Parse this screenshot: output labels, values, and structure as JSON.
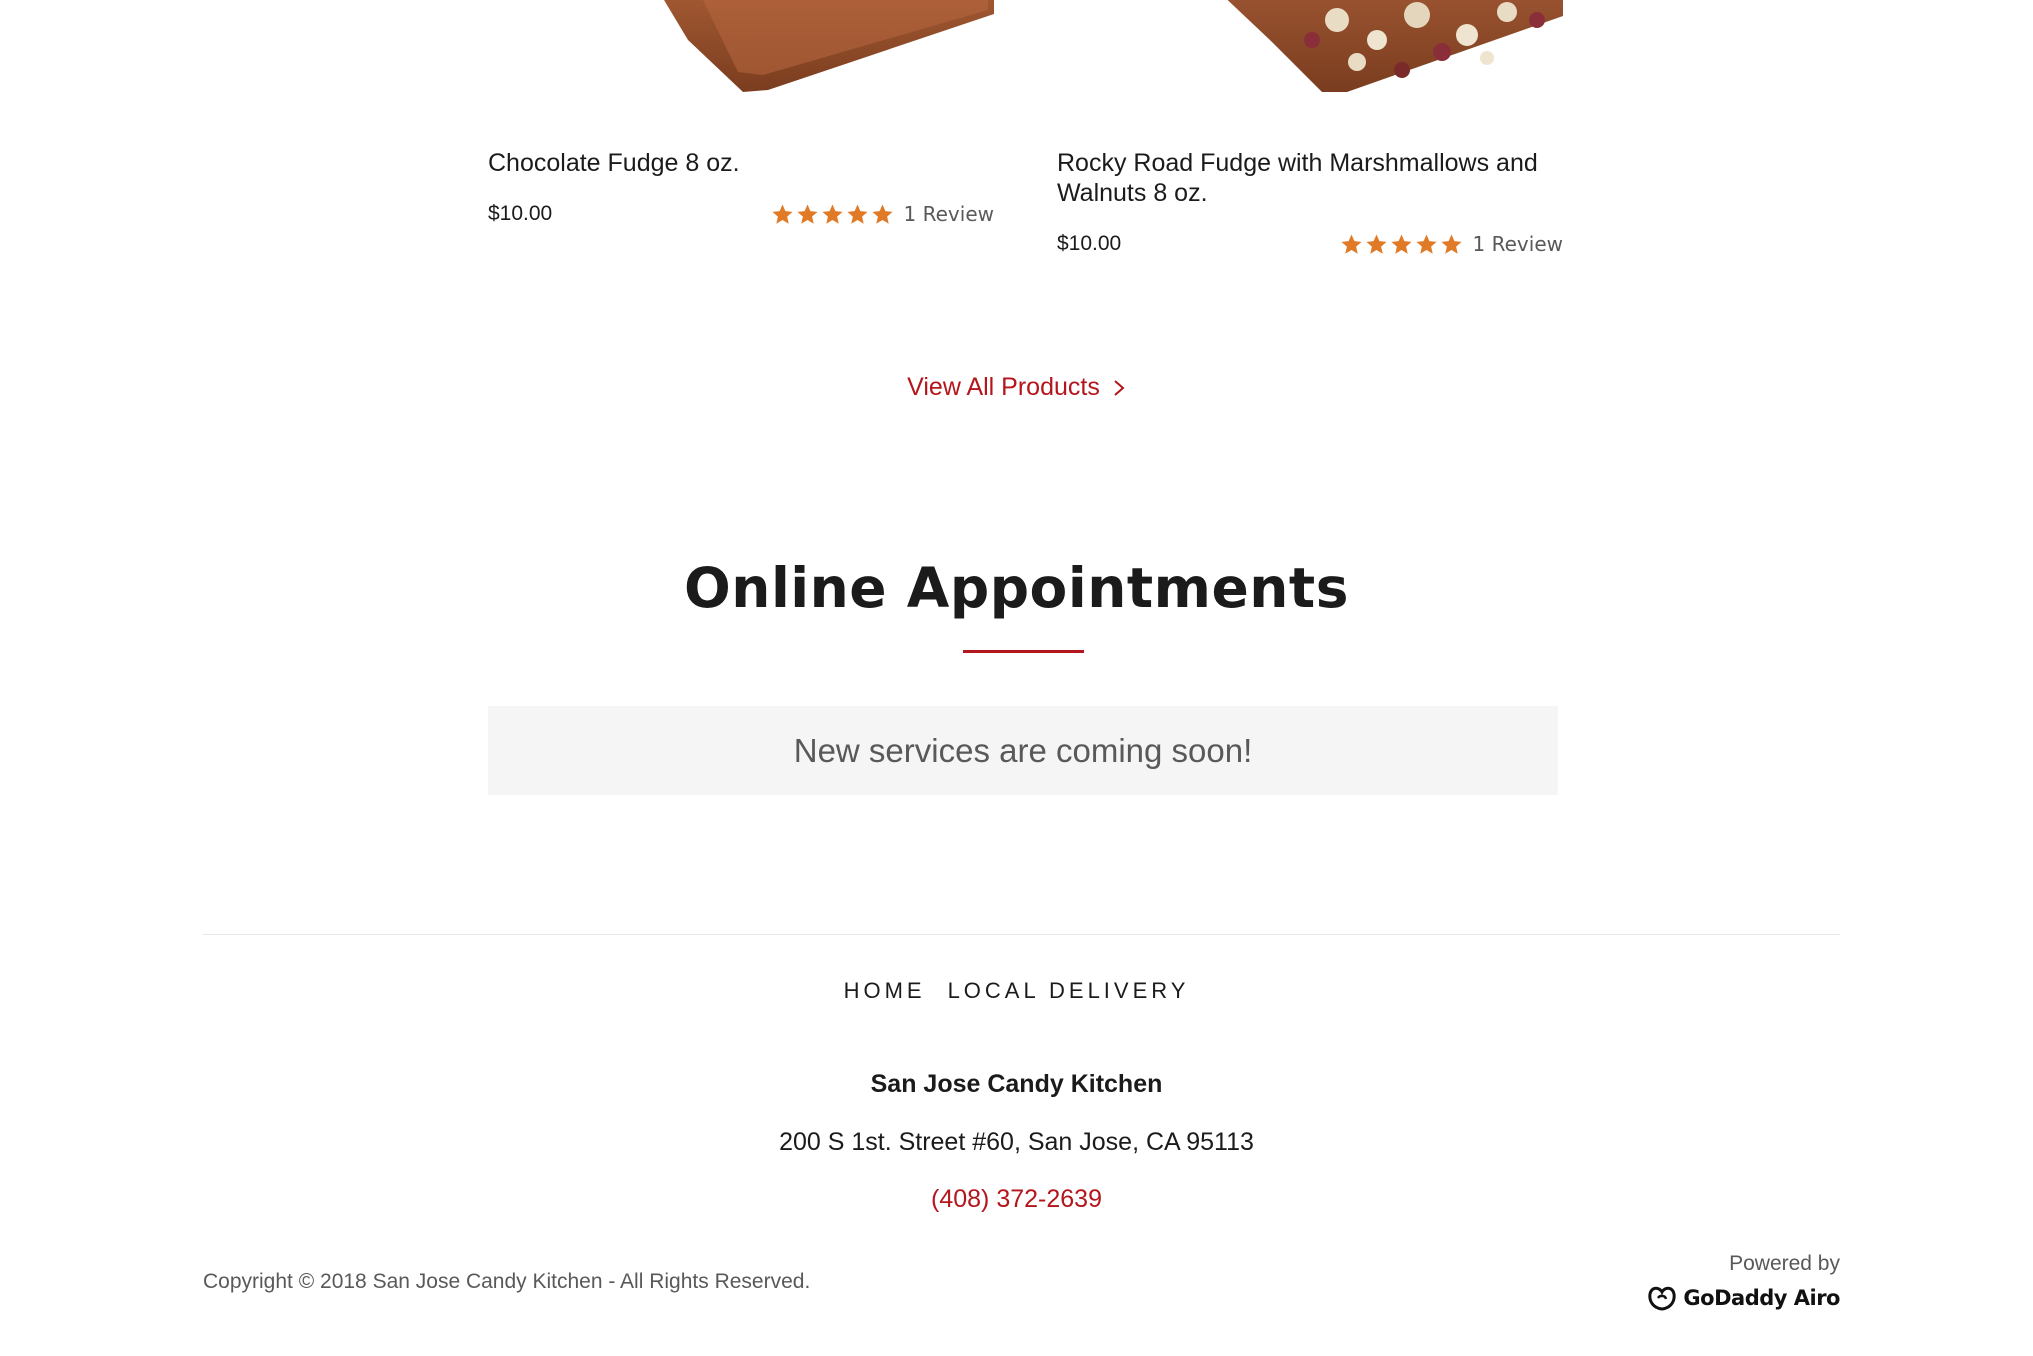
{
  "products": [
    {
      "title": "Chocolate Fudge 8 oz.",
      "price": "$10.00",
      "rating": 5,
      "rating_max": 5,
      "reviews": "1 Review"
    },
    {
      "title": "Rocky Road Fudge with Marshmallows and Walnuts 8 oz.",
      "price": "$10.00",
      "rating": 5,
      "rating_max": 5,
      "reviews": "1 Review"
    }
  ],
  "view_all": {
    "label": "View All Products",
    "icon": "chevron-right-icon"
  },
  "appointments": {
    "title": "Online Appointments",
    "notice": "New services are coming soon!"
  },
  "footer": {
    "nav": [
      "HOME",
      "LOCAL DELIVERY"
    ],
    "business_name": "San Jose Candy Kitchen",
    "address": "200 S 1st. Street #60, San Jose, CA 95113",
    "phone": "(408) 372-2639",
    "copyright": "Copyright © 2018 San Jose Candy Kitchen - All Rights Reserved.",
    "powered_by": "Powered by",
    "brand": "GoDaddy Airo"
  },
  "colors": {
    "accent": "#b3161c",
    "star": "#e07a26",
    "text": "#1b1b1b",
    "muted": "#595959",
    "notice_bg": "#f5f5f5"
  }
}
